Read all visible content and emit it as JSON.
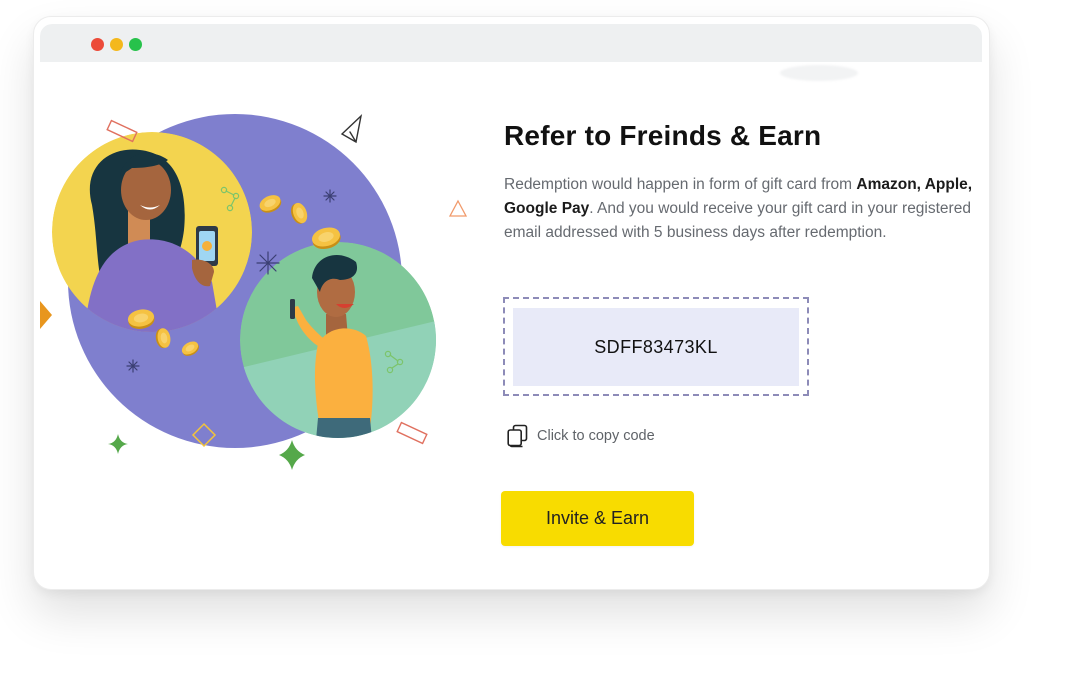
{
  "window": {
    "controls": [
      "close",
      "minimize",
      "maximize"
    ]
  },
  "referral": {
    "title": "Refer to Freinds & Earn",
    "description_start": "Redemption would happen in form of gift card from ",
    "description_highlight": "Amazon, Apple, Google Pay",
    "description_end": ". And you would receive your gift card in your registered email addressed with 5 business days after redemption.",
    "code": "SDFF83473KL",
    "copy_label": "Click to copy code",
    "button_label": "Invite & Earn"
  },
  "colors": {
    "accent_yellow": "#f8dc00",
    "code_background": "#e8eaf8",
    "code_border": "#8d8bb8",
    "purple_blob": "#7f7fce",
    "yellow_circle": "#f3d44f",
    "green_circle": "#80c89a"
  },
  "icons": {
    "copy": "copy-icon",
    "illustration": "referral-illustration"
  }
}
